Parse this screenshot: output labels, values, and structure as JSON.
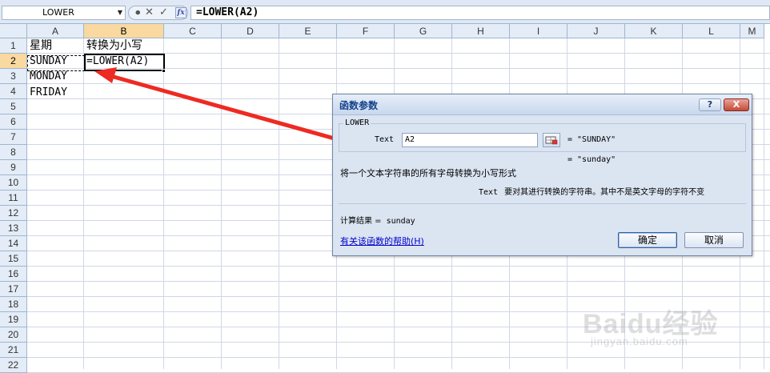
{
  "formula_bar": {
    "name_box": "LOWER",
    "cancel_symbol": "✕",
    "enter_symbol": "✓",
    "fx_label": "fx",
    "formula": "=LOWER(A2)"
  },
  "columns": [
    "A",
    "B",
    "C",
    "D",
    "E",
    "F",
    "G",
    "H",
    "I",
    "J",
    "K",
    "L",
    "M"
  ],
  "rows": [
    "1",
    "2",
    "3",
    "4",
    "5",
    "6",
    "7",
    "8",
    "9",
    "10",
    "11",
    "12",
    "13",
    "14",
    "15",
    "16",
    "17",
    "18",
    "19",
    "20",
    "21",
    "22"
  ],
  "active_column": "B",
  "active_row": "2",
  "cells": {
    "A1": "星期",
    "B1": "转换为小写",
    "A2": "SUNDAY",
    "B2": "=LOWER(A2)",
    "A3": "MONDAY",
    "A4": "FRIDAY"
  },
  "dialog": {
    "title": "函数参数",
    "help_button": "?",
    "close_button": "X",
    "function_name": "LOWER",
    "arg_label": "Text",
    "arg_input": "A2",
    "arg_value": "= \"SUNDAY\"",
    "result_preview": "= \"sunday\"",
    "function_description": "将一个文本字符串的所有字母转换为小写形式",
    "arg_desc_name": "Text",
    "arg_description": "要对其进行转换的字符串。其中不是英文字母的字符不变",
    "calc_result_label": "计算结果 =",
    "calc_result_value": "sunday",
    "help_link": "有关该函数的帮助(H)",
    "ok_label": "确定",
    "cancel_label": "取消"
  },
  "watermark": {
    "text": "Baidu经验",
    "sub": "jingyan.baidu.com"
  },
  "colors": {
    "arrow": "#ee2a22",
    "header_bg": "#e4ecf7",
    "active_header_bg": "#f9d99f",
    "dialog_bg": "#dbe4f1"
  }
}
